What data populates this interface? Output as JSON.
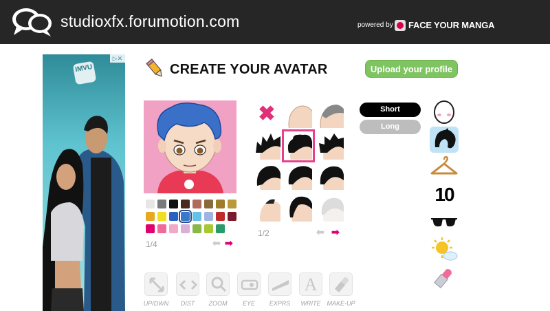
{
  "header": {
    "site_name": "studioxfx.forumotion.com",
    "powered_by": "powered by",
    "brand": "FACE YOUR MANGA"
  },
  "ad": {
    "badge": "▷✕",
    "logo_text": "IMVU"
  },
  "editor": {
    "title": "CREATE YOUR AVATAR",
    "upload_button": "Upload your profile",
    "colors_page": "1/4",
    "hair_page": "1/2",
    "swatch_colors": [
      "#e6e6e6",
      "#7a7a7a",
      "#111111",
      "#4a2a1e",
      "#b06a5e",
      "#8a6a3a",
      "#a07c2a",
      "#b89a3a",
      "#e8a820",
      "#f2de20",
      "#2a62c0",
      "#3a78c8",
      "#68c0e8",
      "#a0b4e0",
      "#c02a2a",
      "#7a1a2a",
      "#e0006e",
      "#f06a9a",
      "#f0aac8",
      "#d8b0d8",
      "#8ab848",
      "#a8c830",
      "#2a9a6a"
    ],
    "selected_swatch": 11,
    "selected_hair": 4,
    "length_short": "Short",
    "length_long": "Long"
  },
  "toolbar": {
    "items": [
      "UP/DWN",
      "DIST",
      "ZOOM",
      "EYE",
      "EXPRS",
      "WRITE",
      "MAKE-UP"
    ]
  },
  "categories": [
    "face-icon",
    "hair-icon",
    "clothes-hanger-icon",
    "number-icon",
    "sunglasses-icon",
    "weather-icon",
    "lipstick-icon"
  ],
  "category_number_label": "10",
  "accent_color": "#e0007a"
}
